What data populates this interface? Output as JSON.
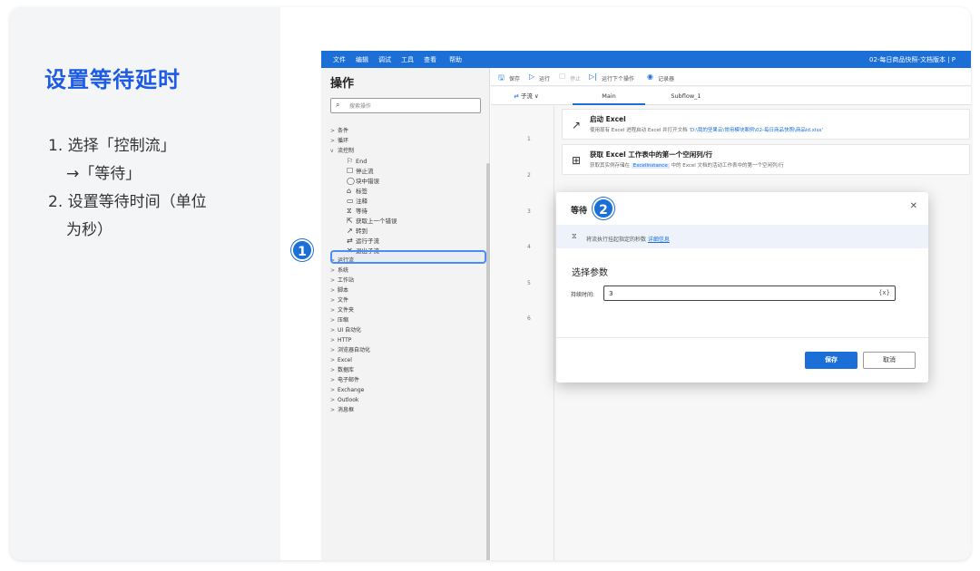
{
  "tutorial": {
    "title": "设置等待延时",
    "steps": [
      "1. 选择「控制流」",
      "→「等待」",
      "2. 设置等待时间（单位",
      "为秒）"
    ]
  },
  "markers": [
    "1",
    "2"
  ],
  "menubar": {
    "items": [
      "文件",
      "编辑",
      "调试",
      "工具",
      "查看",
      "帮助"
    ],
    "window_title": "02-每日商品快照-文档版本 | P"
  },
  "sidebar": {
    "title": "操作",
    "search_placeholder": "搜索操作",
    "items": [
      {
        "caret": ">",
        "label": "条件"
      },
      {
        "caret": ">",
        "label": "循环"
      },
      {
        "caret": "v",
        "label": "流控制"
      }
    ],
    "flow_items": [
      {
        "icon": "⚐",
        "label": "End"
      },
      {
        "icon": "☐",
        "label": "停止流"
      },
      {
        "icon": "◯",
        "label": "块中错误"
      },
      {
        "icon": "⌂",
        "label": "标签"
      },
      {
        "icon": "▭",
        "label": "注释"
      },
      {
        "icon": "⧖",
        "label": "等待"
      },
      {
        "icon": "⇱",
        "label": "获取上一个错误"
      },
      {
        "icon": "↗",
        "label": "转到"
      },
      {
        "icon": "⇄",
        "label": "运行子流"
      },
      {
        "icon": "✕",
        "label": "退出子流"
      }
    ],
    "more_items": [
      "运行流",
      "系统",
      "工作站",
      "脚本",
      "文件",
      "文件夹",
      "压缩",
      "UI 自动化",
      "HTTP",
      "浏览器自动化",
      "Excel",
      "数据库",
      "电子邮件",
      "Exchange",
      "Outlook",
      "消息框"
    ]
  },
  "toolbar": {
    "save": "保存",
    "run": "运行",
    "stop": "停止",
    "run_next": "运行下个操作",
    "recorder": "记录器"
  },
  "tabs": {
    "subflow": "子流",
    "main": "Main",
    "subflow1": "Subflow_1"
  },
  "line_numbers": [
    "1",
    "2",
    "3",
    "4",
    "5",
    "6"
  ],
  "actions": [
    {
      "title": "启动 Excel",
      "desc_prefix": "使用现有 Excel 进程启动 Excel 并打开文档 ",
      "desc_path": "'D:\\我的坚果云\\常用模块案例\\02-每日商品快照\\商品id.xlsx'"
    },
    {
      "title": "获取 Excel 工作表中的第一个空闲列/行",
      "desc_prefix": "获取其实例存储在 ",
      "desc_tag": "ExcelInstance",
      "desc_suffix": " 中的 Excel 文档的活动工作表中的第一个空闲列/行"
    }
  ],
  "dialog": {
    "title": "等待",
    "info_text": "将流执行挂起指定的秒数 ",
    "info_link": "详细信息",
    "section": "选择参数",
    "field_label": "持续时间:",
    "field_value": "3",
    "var_button": "{x}",
    "save": "保存",
    "cancel": "取消"
  }
}
